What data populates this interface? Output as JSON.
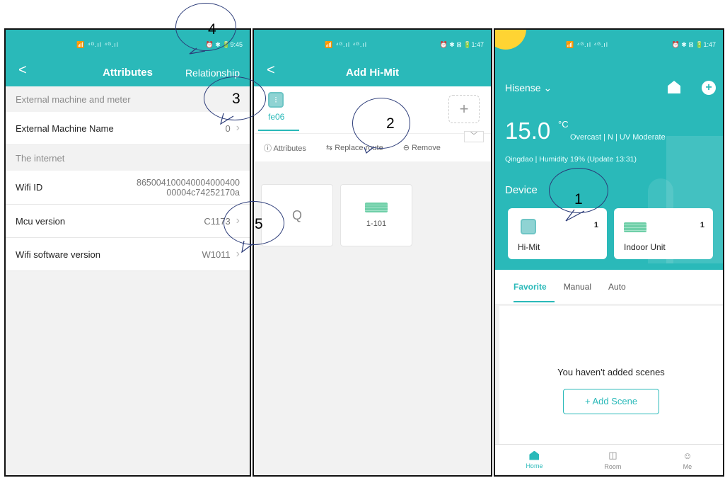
{
  "screen1": {
    "status": {
      "signal": "📶 ⁴ᴳ.ıl ⁴ᴳ.ıl",
      "right": "⏰ ✱ 🔋9:45"
    },
    "nav": {
      "back": "<",
      "title": "Attributes",
      "right": "Relationship"
    },
    "sections": [
      {
        "header": "External machine and meter"
      },
      {
        "header": "The internet"
      }
    ],
    "rows": {
      "ext_name": {
        "label": "External Machine Name",
        "value": "0"
      },
      "wifi_id": {
        "label": "Wifi ID",
        "value_line1": "865004100040004000400",
        "value_line2": "00004c74252170a"
      },
      "mcu": {
        "label": "Mcu version",
        "value": "C1173"
      },
      "wifi_sw": {
        "label": "Wifi software version",
        "value": "W1011"
      }
    }
  },
  "screen2": {
    "status": {
      "signal": "📶 ⁴ᴳ.ıl ⁴ᴳ.ıl",
      "right": "⏰ ✱ ⊠ 🔋1:47"
    },
    "nav": {
      "back": "<",
      "title": "Add Hi-Mit"
    },
    "tile_name": "fe06",
    "add_symbol": "+",
    "actions": {
      "attributes": "ⓘ Attributes",
      "replace": "⇆ Replace route",
      "remove": "⊖ Remove"
    },
    "dropdown": "﹀",
    "cards": [
      {
        "symbol": "Q",
        "label": ""
      },
      {
        "label": "1-101"
      }
    ]
  },
  "screen3": {
    "status": {
      "signal": "📶 ⁴ᴳ.ıl ⁴ᴳ.ıl",
      "right": "⏰ ✱ ⊠ 🔋1:47"
    },
    "brand": "Hisense ⌄",
    "plus": "+",
    "temp": "15.0",
    "temp_unit": "°C",
    "weather": "Overcast  |  N  |  UV Moderate",
    "location": "Qingdao  |  Humidity 19%  (Update 13:31)",
    "device_label": "Device",
    "devices": [
      {
        "name": "Hi-Mit",
        "count": "1"
      },
      {
        "name": "Indoor Unit",
        "count": "1"
      }
    ],
    "tabs": [
      "Favorite",
      "Manual",
      "Auto"
    ],
    "empty_msg": "You haven't added scenes",
    "add_scene": "+   Add Scene",
    "bottom_nav": [
      {
        "label": "Home",
        "glyph": ""
      },
      {
        "label": "Room",
        "glyph": "◫"
      },
      {
        "label": "Me",
        "glyph": "☺"
      }
    ]
  },
  "callouts": [
    "1",
    "2",
    "3",
    "4",
    "5"
  ],
  "colors": {
    "teal": "#2ab9b9",
    "sun": "#ffd433",
    "callout_line": "#2b3b78"
  }
}
